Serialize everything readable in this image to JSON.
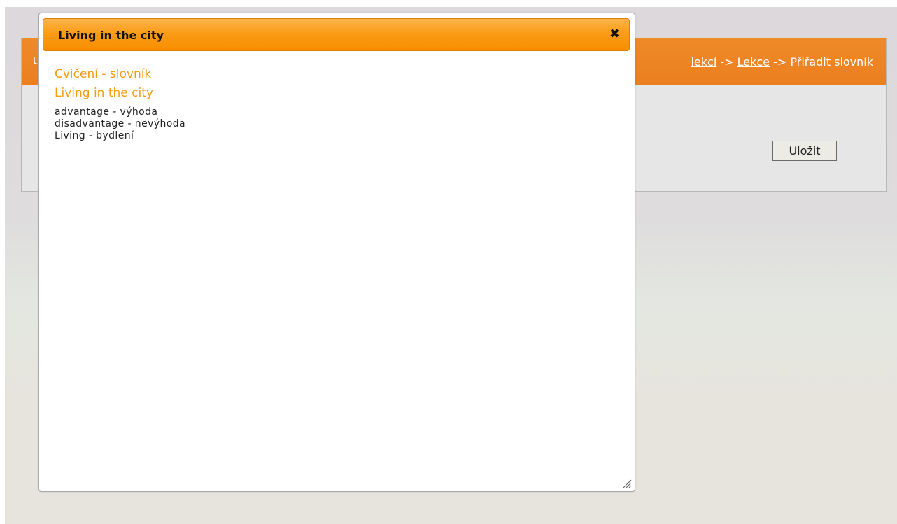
{
  "background_page": {
    "header_edge_char": "U",
    "breadcrumb": {
      "link1": "lekcí",
      "sep1": " -> ",
      "link2": "Lekce",
      "sep2": " -> ",
      "current": "Přiřadit slovník"
    },
    "save_label": "Uložit"
  },
  "dialog": {
    "title": "Living in the city",
    "close_icon": "close-icon",
    "exercise_type": "Cvičení - slovník",
    "vocabulary_title": "Living in the city",
    "items": [
      "advantage - výhoda",
      "disadvantage - nevýhoda",
      "Living - bydlení"
    ],
    "resize_icon": "resize-grip-icon"
  },
  "colors": {
    "header_orange": "#ec7f1f",
    "dialog_title_orange": "#fb9c17",
    "accent_text": "#f39c12"
  }
}
